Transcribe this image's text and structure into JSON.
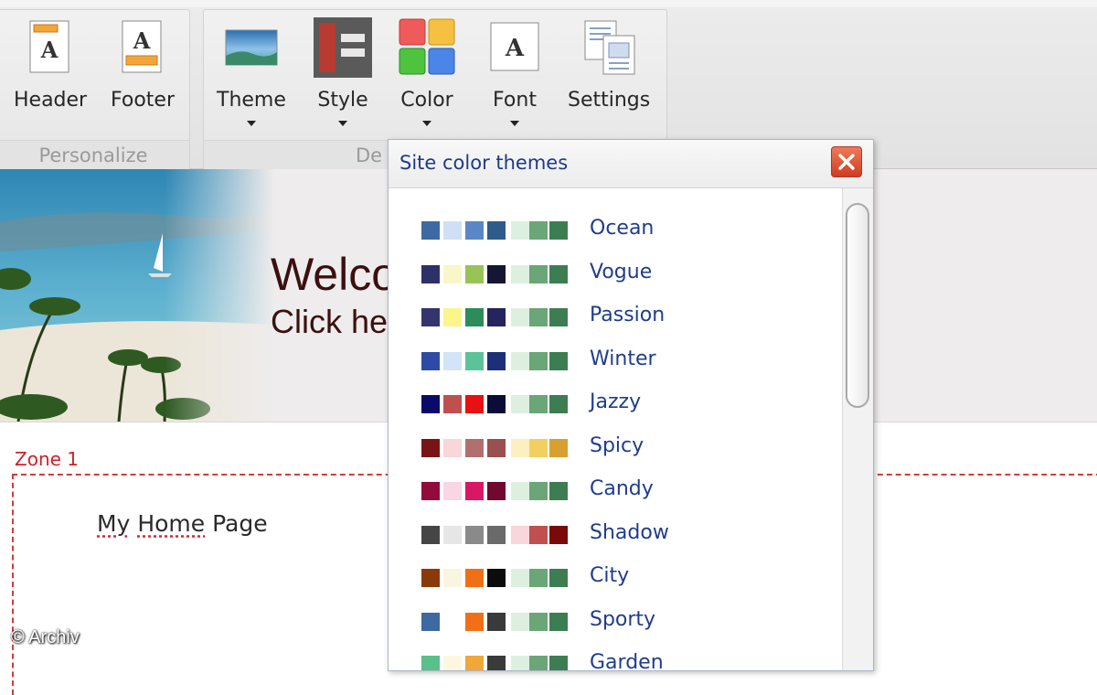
{
  "ribbon": {
    "groups": {
      "personalize": "Personalize",
      "design": "De"
    },
    "buttons": {
      "header": "Header",
      "footer": "Footer",
      "theme": "Theme",
      "style": "Style",
      "color": "Color",
      "font": "Font",
      "settings": "Settings"
    },
    "icons": {
      "header": "page-header-icon",
      "footer": "page-footer-icon",
      "theme": "landscape-icon",
      "style": "style-layout-icon",
      "color": "color-grid-icon",
      "font": "font-a-icon",
      "settings": "settings-pages-icon"
    }
  },
  "banner": {
    "welcome": "Welco",
    "click_here": "Click he"
  },
  "zone": {
    "label": "Zone 1",
    "page_title_word1": "My",
    "page_title_word2": "Home",
    "page_title_word3": "Page"
  },
  "watermark": "© Archiv",
  "popup": {
    "title": "Site color themes",
    "close_icon": "close-icon",
    "themes": [
      {
        "name": "Ocean",
        "colors": [
          "#3d6aa0",
          "#cfe0f4",
          "#5b86c3",
          "#2f5b8a",
          "#ddf0e0",
          "#6aa677",
          "#3d7d52"
        ]
      },
      {
        "name": "Vogue",
        "colors": [
          "#2e3168",
          "#f8f7c8",
          "#98c457",
          "#141634",
          "#ddf0e0",
          "#6aa677",
          "#3d7d52"
        ]
      },
      {
        "name": "Passion",
        "colors": [
          "#34356e",
          "#fbf58a",
          "#2c8c5a",
          "#25245c",
          "#ddf0e0",
          "#6aa677",
          "#3d7d52"
        ]
      },
      {
        "name": "Winter",
        "colors": [
          "#2f4aa4",
          "#d2e4f7",
          "#5cc29a",
          "#1c2f78",
          "#ddf0e0",
          "#6aa677",
          "#3d7d52"
        ]
      },
      {
        "name": "Jazzy",
        "colors": [
          "#0a0a6a",
          "#c05050",
          "#e81010",
          "#0c0c38",
          "#ddf0e0",
          "#6aa677",
          "#3d7d52"
        ]
      },
      {
        "name": "Spicy",
        "colors": [
          "#7a1414",
          "#f8d6da",
          "#b07070",
          "#9a5050",
          "#fdf0c0",
          "#f2d060",
          "#d7a030"
        ]
      },
      {
        "name": "Candy",
        "colors": [
          "#900c3a",
          "#f8d6e4",
          "#d81866",
          "#700830",
          "#ddf0e0",
          "#6aa677",
          "#3d7d52"
        ]
      },
      {
        "name": "Shadow",
        "colors": [
          "#454545",
          "#e6e6e6",
          "#8a8a8a",
          "#6a6a6a",
          "#f8d6da",
          "#c05050",
          "#7a0a0a"
        ]
      },
      {
        "name": "City",
        "colors": [
          "#8a3a0a",
          "#faf5e0",
          "#f07018",
          "#0c0c0c",
          "#ddf0e0",
          "#6aa677",
          "#3d7d52"
        ]
      },
      {
        "name": "Sporty",
        "colors": [
          "#3d6aa0",
          "#ffffff",
          "#f07018",
          "#3a3a3a",
          "#ddf0e0",
          "#6aa677",
          "#3d7d52"
        ]
      },
      {
        "name": "Garden",
        "colors": [
          "#58c088",
          "#fdf7e0",
          "#f0a838",
          "#3a3a3a",
          "#ddf0e0",
          "#6aa677",
          "#3d7d52"
        ]
      }
    ]
  }
}
